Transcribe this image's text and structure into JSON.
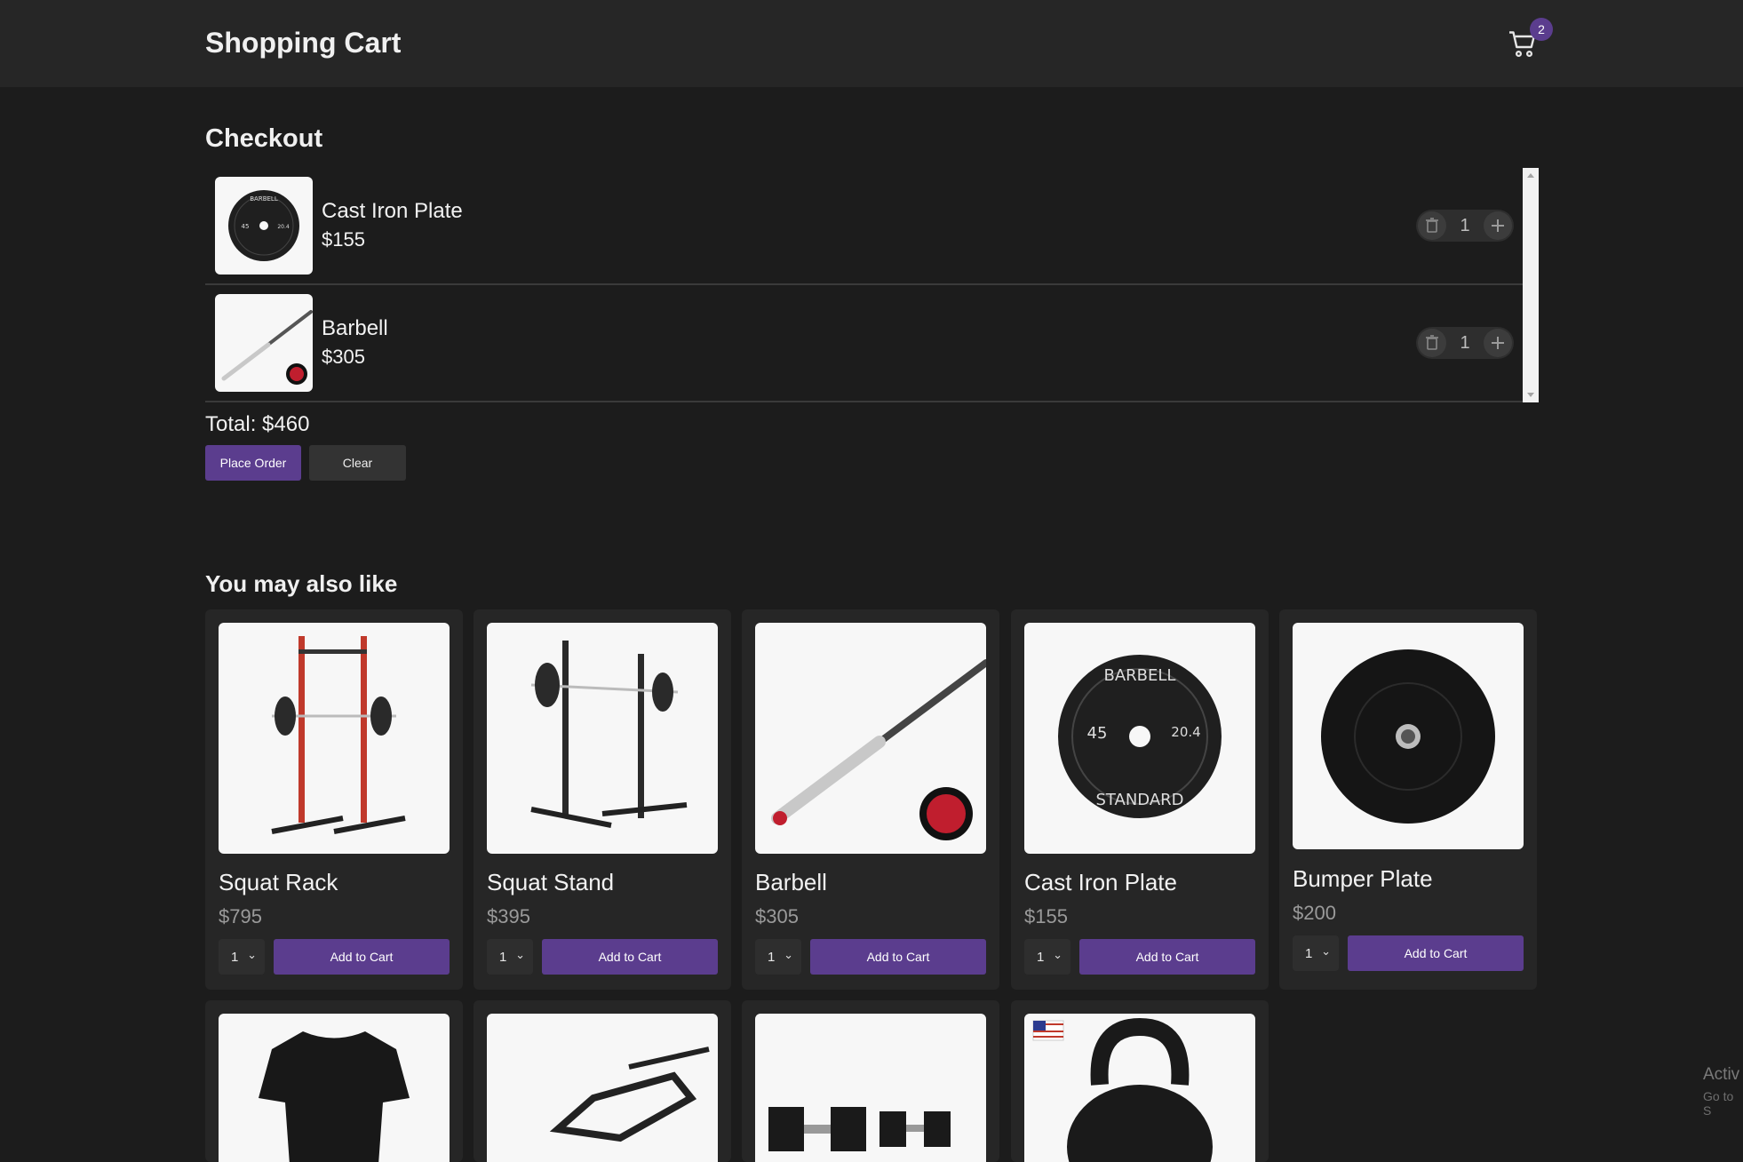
{
  "header": {
    "title": "Shopping Cart",
    "cart_count": "2"
  },
  "checkout": {
    "title": "Checkout",
    "items": [
      {
        "name": "Cast Iron Plate",
        "price": "$155",
        "quantity": "1",
        "image": "cast-iron-plate"
      },
      {
        "name": "Barbell",
        "price": "$305",
        "quantity": "1",
        "image": "barbell"
      }
    ],
    "total": "Total: $460",
    "place_order_label": "Place Order",
    "clear_label": "Clear"
  },
  "recommendations": {
    "title": "You may also like",
    "products": [
      {
        "name": "Squat Rack",
        "price": "$795",
        "quantity": "1",
        "add_label": "Add to Cart",
        "image": "squat-rack"
      },
      {
        "name": "Squat Stand",
        "price": "$395",
        "quantity": "1",
        "add_label": "Add to Cart",
        "image": "squat-stand"
      },
      {
        "name": "Barbell",
        "price": "$305",
        "quantity": "1",
        "add_label": "Add to Cart",
        "image": "barbell"
      },
      {
        "name": "Cast Iron Plate",
        "price": "$155",
        "quantity": "1",
        "add_label": "Add to Cart",
        "image": "cast-iron-plate"
      },
      {
        "name": "Bumper Plate",
        "price": "$200",
        "quantity": "1",
        "add_label": "Add to Cart",
        "image": "bumper-plate"
      },
      {
        "image": "t-shirt"
      },
      {
        "image": "trap-bar"
      },
      {
        "image": "dumbbells"
      },
      {
        "image": "kettlebell"
      }
    ]
  },
  "watermark": {
    "line1": "Activ",
    "line2": "Go to S"
  },
  "colors": {
    "background": "#1c1c1c",
    "header": "#262626",
    "accent": "#5b3d8e",
    "card": "#262626"
  },
  "icons": {
    "cart": "cart-icon",
    "delete": "trash-icon",
    "add": "plus-icon",
    "dropdown": "chevron-down-icon"
  }
}
